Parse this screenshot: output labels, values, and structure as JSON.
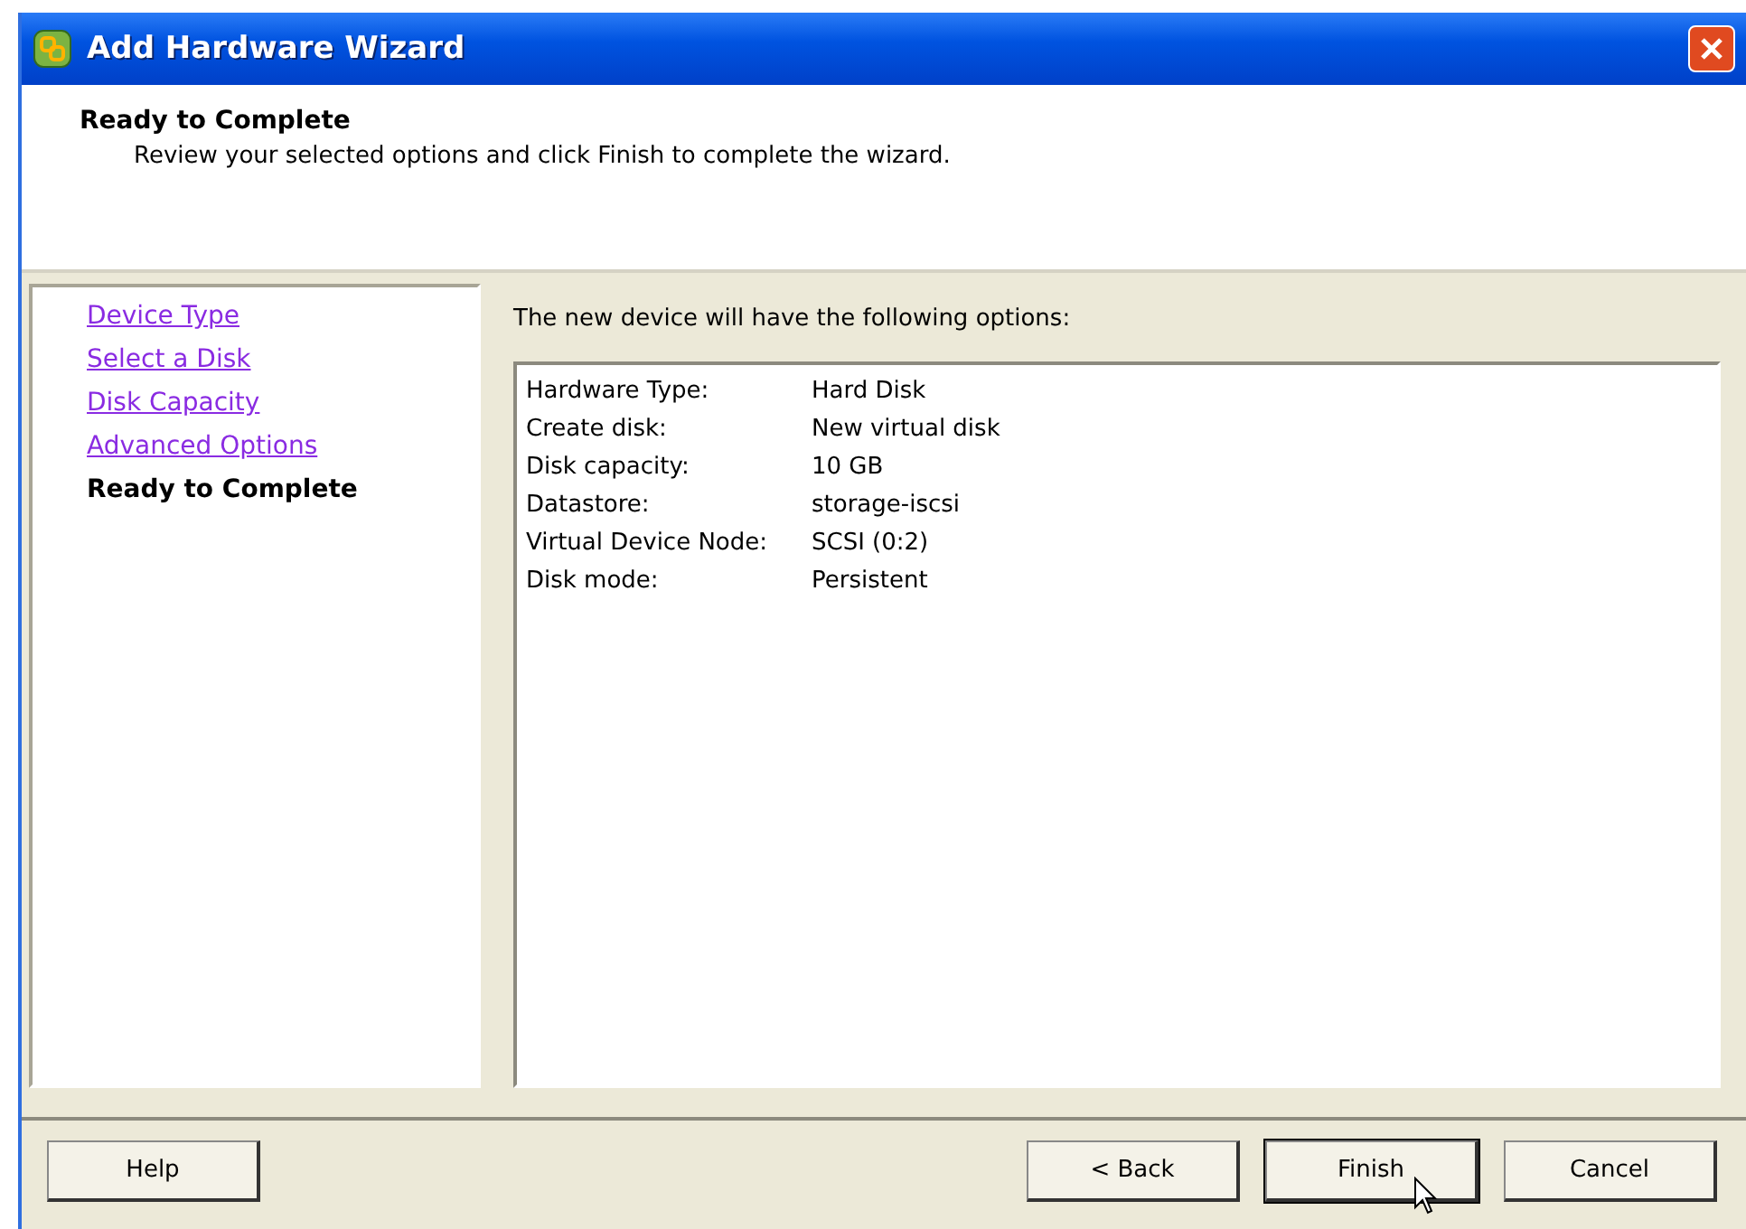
{
  "window": {
    "title": "Add Hardware Wizard"
  },
  "header": {
    "title": "Ready to Complete",
    "subtitle": "Review your selected options and click Finish to complete the wizard."
  },
  "steps": [
    {
      "label": "Device Type",
      "selected": false
    },
    {
      "label": "Select a Disk",
      "selected": false
    },
    {
      "label": "Disk Capacity",
      "selected": false
    },
    {
      "label": "Advanced Options",
      "selected": false
    },
    {
      "label": "Ready to Complete",
      "selected": true
    }
  ],
  "summary": {
    "intro": "The new device will have the following options:",
    "rows": [
      {
        "label": "Hardware Type:",
        "value": "Hard Disk"
      },
      {
        "label": "Create disk:",
        "value": "New virtual disk"
      },
      {
        "label": "Disk capacity:",
        "value": "10 GB"
      },
      {
        "label": "Datastore:",
        "value": "storage-iscsi"
      },
      {
        "label": "Virtual Device Node:",
        "value": "SCSI (0:2)"
      },
      {
        "label": "Disk mode:",
        "value": "Persistent"
      }
    ]
  },
  "buttons": [
    {
      "label": "Help",
      "kind": "help",
      "default": false
    },
    {
      "label": "< Back",
      "kind": "nav",
      "default": false
    },
    {
      "label": "Finish",
      "kind": "nav",
      "default": true
    },
    {
      "label": "Cancel",
      "kind": "nav",
      "default": false
    }
  ]
}
